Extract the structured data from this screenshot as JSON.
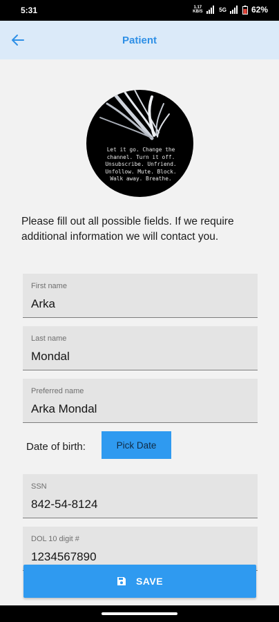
{
  "status_bar": {
    "time": "5:31",
    "speed_value": "1.17",
    "speed_unit": "KB/S",
    "network_label": "5G",
    "battery": "62%"
  },
  "header": {
    "title": "Patient",
    "back_icon": "arrow-left-icon",
    "background": "#dbeaf9",
    "accent": "#2e8fe6"
  },
  "avatar": {
    "quote_lines": [
      "Let it go. Change the",
      "channel. Turn it off.",
      "Unsubscribe. Unfriend.",
      "Unfollow. Mute. Block.",
      "Walk away. Breathe."
    ]
  },
  "form": {
    "intro": "Please fill out all possible fields. If we require additional information we will contact you.",
    "first_name": {
      "label": "First name",
      "value": "Arka"
    },
    "last_name": {
      "label": "Last name",
      "value": "Mondal"
    },
    "preferred_name": {
      "label": "Preferred name",
      "value": "Arka Mondal"
    },
    "dob": {
      "label": "Date of birth:",
      "button": "Pick Date"
    },
    "ssn": {
      "label": "SSN",
      "value": "842-54-8124"
    },
    "dol": {
      "label": "DOL 10 digit #",
      "value": "1234567890"
    }
  },
  "actions": {
    "save": "SAVE",
    "save_icon": "floppy-disk-icon",
    "button_color": "#2f9af0"
  }
}
